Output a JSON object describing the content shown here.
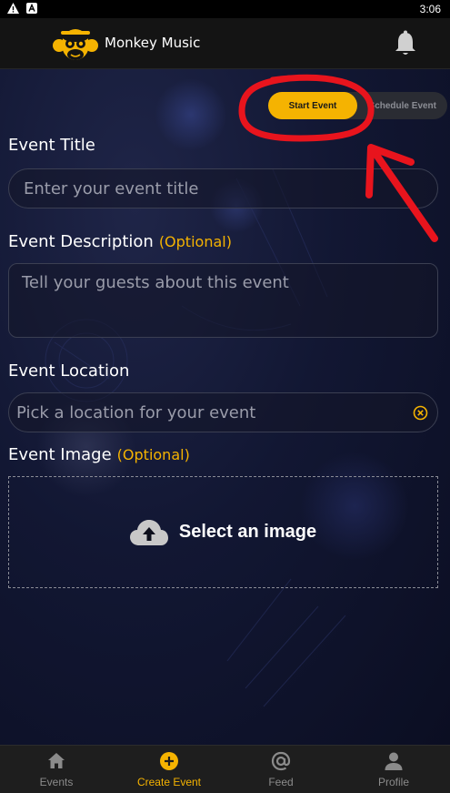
{
  "status_bar": {
    "time": "3:06"
  },
  "header": {
    "app_title": "Monkey Music"
  },
  "mode_toggle": {
    "start_label": "Start Event",
    "schedule_label": "Schedule Event"
  },
  "form": {
    "title": {
      "label": "Event Title",
      "placeholder": "Enter your event title"
    },
    "description": {
      "label": "Event Description",
      "optional": "(Optional)",
      "placeholder": "Tell your guests about this event"
    },
    "location": {
      "label": "Event Location",
      "placeholder": "Pick a location for your event"
    },
    "image": {
      "label": "Event Image",
      "optional": "(Optional)",
      "button_label": "Select an image"
    }
  },
  "bottom_nav": {
    "items": [
      {
        "label": "Events",
        "icon": "home-icon",
        "active": false
      },
      {
        "label": "Create Event",
        "icon": "plus-circle-icon",
        "active": true
      },
      {
        "label": "Feed",
        "icon": "at-icon",
        "active": false
      },
      {
        "label": "Profile",
        "icon": "person-icon",
        "active": false
      }
    ]
  },
  "colors": {
    "accent": "#f5b301",
    "annotation": "#e8141d",
    "background": "#121733"
  }
}
